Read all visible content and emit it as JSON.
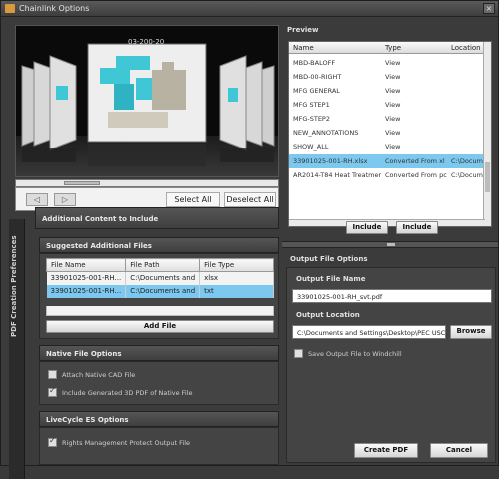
{
  "window": {
    "title": "Chainlink Options",
    "close_glyph": "×"
  },
  "viewer": {
    "label": "03-200-20",
    "nav_prev": "◁",
    "nav_next": "▷",
    "select_all": "Select All",
    "deselect_all": "Deselect All"
  },
  "vertical_tab": "PDF Creation Preferences",
  "additional_content": {
    "title": "Additional Content to Include"
  },
  "suggested": {
    "title": "Suggested Additional Files",
    "columns": [
      "File Name",
      "File Path",
      "File Type"
    ],
    "rows": [
      {
        "name": "33901025-001-RH...",
        "path": "C:\\Documents and",
        "type": "xlsx"
      },
      {
        "name": "33901025-001-RH...",
        "path": "C:\\Documents and",
        "type": "txt"
      }
    ],
    "selected_row": 1,
    "add_file": "Add File"
  },
  "native": {
    "title": "Native File Options",
    "options": [
      {
        "label": "Attach Native CAD File",
        "checked": false
      },
      {
        "label": "Include Generated 3D PDF of Native File",
        "checked": true
      }
    ]
  },
  "livecycle": {
    "title": "LiveCycle ES Options",
    "options": [
      {
        "label": "Rights Management Protect Output File",
        "checked": true
      }
    ]
  },
  "preview": {
    "title": "Preview",
    "columns": [
      "Name",
      "Type",
      "Location"
    ],
    "rows": [
      {
        "name": "MBD-BALOFF",
        "type": "View",
        "loc": ""
      },
      {
        "name": "MBD-00-RIGHT",
        "type": "View",
        "loc": ""
      },
      {
        "name": "MFG GENERAL",
        "type": "View",
        "loc": ""
      },
      {
        "name": "MFG STEP1",
        "type": "View",
        "loc": ""
      },
      {
        "name": "MFG-STEP2",
        "type": "View",
        "loc": ""
      },
      {
        "name": "NEW_ANNOTATIONS",
        "type": "View",
        "loc": ""
      },
      {
        "name": "SHOW_ALL",
        "type": "View",
        "loc": ""
      },
      {
        "name": "33901025-001-RH.xlsx",
        "type": "Converted From xl",
        "loc": "C:\\Docume"
      },
      {
        "name": "AR2014-T84 Heat Treatmer",
        "type": "Converted From pc",
        "loc": "C:\\Docume"
      }
    ],
    "selected_row": 7,
    "include": "Include",
    "exclude": "Include"
  },
  "output": {
    "title": "Output File Options",
    "file_name_label": "Output File Name",
    "file_name_value": "33901025-001-RH_svt.pdf",
    "location_label": "Output Location",
    "location_value": "C:\\Documents and Settings\\Desktop\\PEC USC",
    "browse": "Browse",
    "save_label": "Save Output File to Windchill",
    "save_checked": false
  },
  "footer": {
    "create": "Create PDF",
    "cancel": "Cancel"
  },
  "colors": {
    "selection": "#7cc8ee",
    "panel": "#3b3b3b",
    "accent": "#d89a3a"
  }
}
